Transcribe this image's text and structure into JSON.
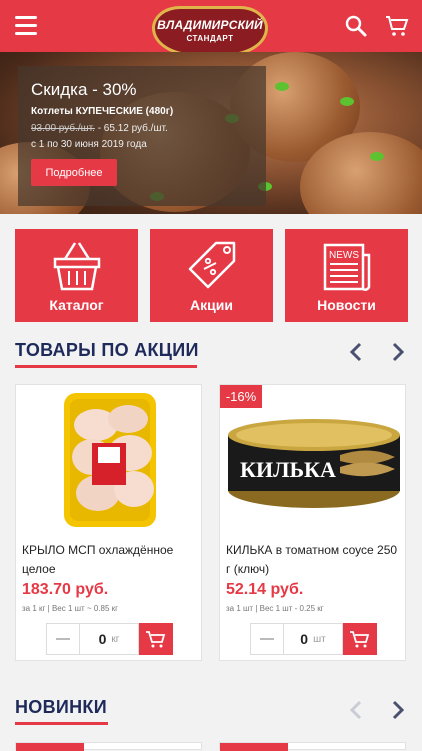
{
  "header": {
    "logo_line1": "ВЛАДИМИРСКИЙ",
    "logo_line2": "СТАНДАРТ"
  },
  "promo": {
    "title": "Скидка - 30%",
    "product": "Котлеты КУПЕЧЕСКИЕ (480г)",
    "old_price": "93.00 руб./шт.",
    "new_price": " - 65.12 руб./шт.",
    "dates": "с 1 по 30 июня 2019 года",
    "button": "Подробнее"
  },
  "tiles": [
    {
      "label": "Каталог",
      "icon": "basket-icon"
    },
    {
      "label": "Акции",
      "icon": "price-tag-icon"
    },
    {
      "label": "Новости",
      "icon": "newspaper-icon",
      "icon_text": "NEWS"
    }
  ],
  "sections": {
    "promo_goods": "ТОВАРЫ ПО АКЦИИ",
    "new_goods": "НОВИНКИ"
  },
  "products": [
    {
      "name": "КРЫЛО МСП охлаждённое целое",
      "price": "183.70 руб.",
      "unit": "за 1 кг  |  Вес 1 шт ~ 0.85 кг",
      "qty": "0",
      "qty_unit": "кг",
      "badge": ""
    },
    {
      "name": "КИЛЬКА в томатном соусе 250 г (ключ)",
      "price": "52.14 руб.",
      "unit": "за 1 шт  |  Вес 1 шт - 0.25 кг",
      "qty": "0",
      "qty_unit": "шт",
      "badge": "-16%",
      "can_text": "КИЛЬКА"
    }
  ],
  "colors": {
    "accent": "#e63946",
    "title": "#1e2b5a"
  }
}
